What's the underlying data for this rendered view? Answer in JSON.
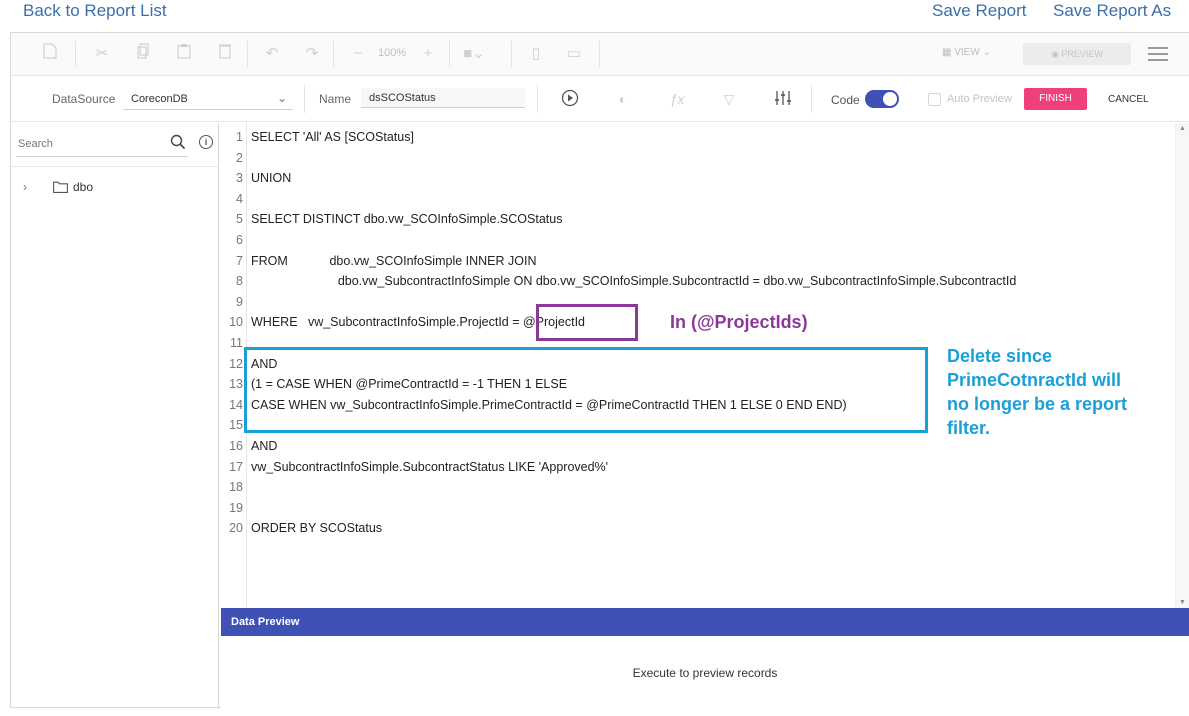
{
  "topbar": {
    "back": "Back to Report List",
    "save": "Save Report",
    "save_as": "Save Report As"
  },
  "toolbar1": {
    "zoom": "100%",
    "view": "VIEW",
    "preview": "PREVIEW"
  },
  "toolbar2": {
    "datasource_label": "DataSource",
    "datasource_value": "CoreconDB",
    "name_label": "Name",
    "name_value": "dsSCOStatus",
    "code_label": "Code",
    "auto_preview_label": "Auto Preview",
    "finish": "FINISH",
    "cancel": "CANCEL"
  },
  "left_panel": {
    "search_placeholder": "Search",
    "tree_item": "dbo"
  },
  "editor": {
    "lines": [
      {
        "n": "1",
        "text": "SELECT 'All' AS [SCOStatus]"
      },
      {
        "n": "2",
        "text": ""
      },
      {
        "n": "3",
        "text": "UNION"
      },
      {
        "n": "4",
        "text": ""
      },
      {
        "n": "5",
        "text": "SELECT DISTINCT dbo.vw_SCOInfoSimple.SCOStatus"
      },
      {
        "n": "6",
        "text": ""
      },
      {
        "n": "7",
        "text": "FROM            dbo.vw_SCOInfoSimple INNER JOIN"
      },
      {
        "n": "8",
        "text": "                         dbo.vw_SubcontractInfoSimple ON dbo.vw_SCOInfoSimple.SubcontractId = dbo.vw_SubcontractInfoSimple.SubcontractId"
      },
      {
        "n": "9",
        "text": ""
      },
      {
        "n": "10",
        "text": "WHERE   vw_SubcontractInfoSimple.ProjectId = @ProjectId"
      },
      {
        "n": "11",
        "text": ""
      },
      {
        "n": "12",
        "text": "AND"
      },
      {
        "n": "13",
        "text": "(1 = CASE WHEN @PrimeContractId = -1 THEN 1 ELSE"
      },
      {
        "n": "14",
        "text": "CASE WHEN vw_SubcontractInfoSimple.PrimeContractId = @PrimeContractId THEN 1 ELSE 0 END END)"
      },
      {
        "n": "15",
        "text": ""
      },
      {
        "n": "16",
        "text": "AND"
      },
      {
        "n": "17",
        "text": "vw_SubcontractInfoSimple.SubcontractStatus LIKE 'Approved%'"
      },
      {
        "n": "18",
        "text": ""
      },
      {
        "n": "19",
        "text": ""
      },
      {
        "n": "20",
        "text": "ORDER BY SCOStatus"
      }
    ]
  },
  "annotations": {
    "purple_text": "In (@ProjectIds)",
    "blue_text": "Delete since PrimeCotnractId will no longer be a report filter."
  },
  "data_preview": {
    "title": "Data Preview",
    "message": "Execute to preview records"
  },
  "colors": {
    "link": "#3a6fa8",
    "accent": "#3f51b5",
    "finish": "#f0407b",
    "annot_purple": "#8a3a96",
    "annot_blue": "#1aa0d8"
  }
}
